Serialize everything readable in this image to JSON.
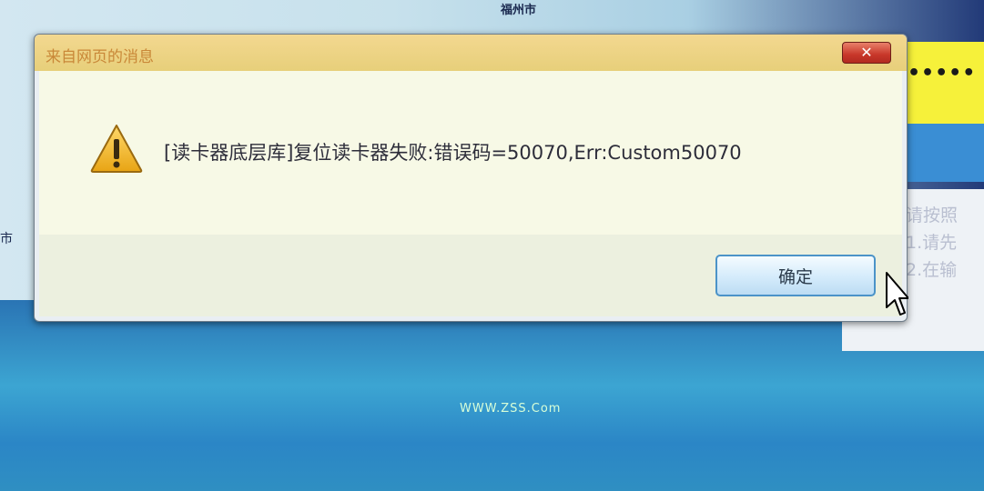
{
  "background": {
    "map_label_left": "市",
    "map_label_top": "福州市",
    "footer_text": "WWW.ZSS.Com"
  },
  "dialog": {
    "title": "来自网页的消息",
    "close_label": "✕",
    "icon": "warning-icon",
    "message": "[读卡器底层库]复位读卡器失败:错误码=50070,Err:Custom50070",
    "ok_label": "确定"
  },
  "right_panel": {
    "masked_value": "•••••",
    "lines": [
      "请按照",
      "1.请先",
      "2.在输"
    ]
  },
  "colors": {
    "titlebar": "#e7cf7a",
    "close_button": "#c8372a",
    "ok_border": "#4b93c8",
    "warning": "#f2b21c"
  }
}
